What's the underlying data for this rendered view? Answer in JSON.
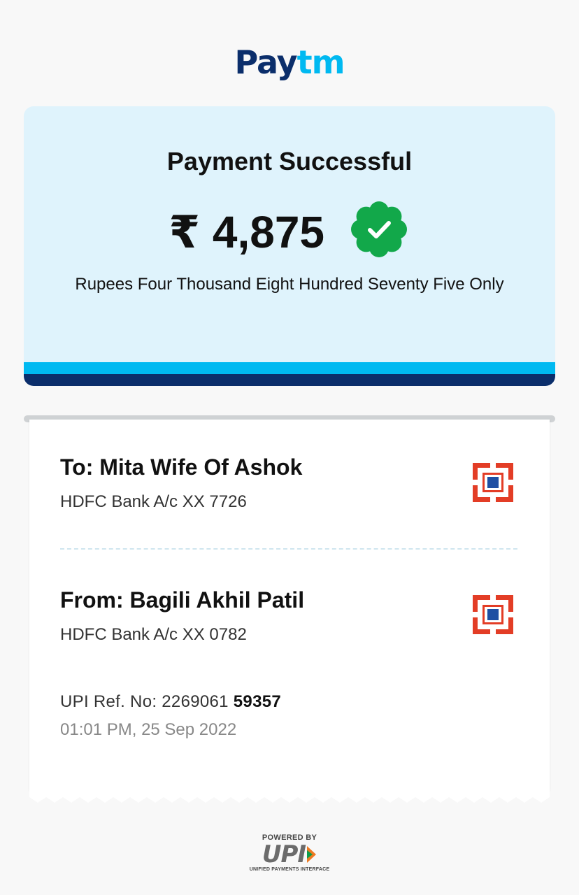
{
  "brand": {
    "pay": "Pay",
    "tm": "tm"
  },
  "status": {
    "title": "Payment Successful",
    "amount": "₹ 4,875",
    "amount_words": "Rupees Four Thousand Eight Hundred Seventy Five Only",
    "badge_color": "#12a84a"
  },
  "transfer": {
    "to": {
      "name": "To: Mita Wife Of Ashok",
      "bank": "HDFC Bank A/c XX 7726"
    },
    "from": {
      "name": "From: Bagili Akhil Patil",
      "bank": "HDFC Bank A/c XX 0782"
    },
    "upi_ref_prefix": "UPI Ref. No: 2269061 ",
    "upi_ref_suffix": "59357",
    "datetime": "01:01 PM, 25 Sep 2022"
  },
  "footer": {
    "powered_by": "POWERED BY",
    "upi": "UPI",
    "upi_full": "UNIFIED PAYMENTS INTERFACE"
  },
  "colors": {
    "brand_dark": "#0b2e6b",
    "brand_light": "#00b9f1",
    "card_bg": "#dff3fc",
    "hdfc_red": "#e33d26",
    "hdfc_blue": "#1f4fa3"
  }
}
